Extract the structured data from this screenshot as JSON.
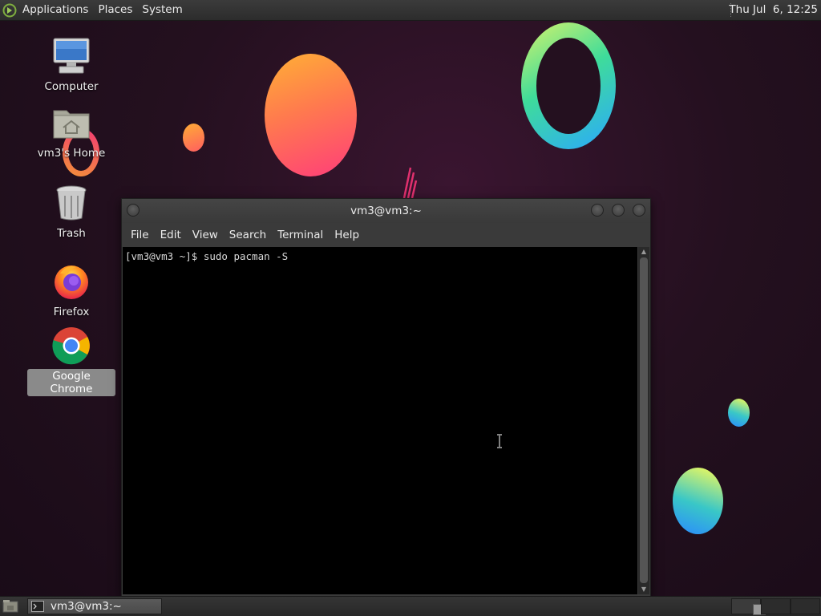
{
  "top_panel": {
    "menus": [
      "Applications",
      "Places",
      "System"
    ],
    "clock": "Thu Jul  6, 12:25"
  },
  "desktop": {
    "icons": [
      {
        "label": "Computer",
        "icon": "computer-icon"
      },
      {
        "label": "vm3's Home",
        "icon": "home-folder-icon"
      },
      {
        "label": "Trash",
        "icon": "trash-icon"
      },
      {
        "label": "Firefox",
        "icon": "firefox-icon"
      },
      {
        "label": "Google Chrome",
        "icon": "chrome-icon",
        "selected": true
      }
    ]
  },
  "terminal": {
    "title": "vm3@vm3:~",
    "menu": [
      "File",
      "Edit",
      "View",
      "Search",
      "Terminal",
      "Help"
    ],
    "lines": [
      "[vm3@vm3 ~]$ sudo pacman -S"
    ]
  },
  "taskbar": {
    "tasks": [
      {
        "label": "vm3@vm3:~",
        "icon": "terminal-icon"
      }
    ],
    "workspaces": 4,
    "active_workspace": 1
  },
  "colors": {
    "background": "#24101f",
    "panel": "#333333",
    "terminal_bg": "#000000"
  }
}
